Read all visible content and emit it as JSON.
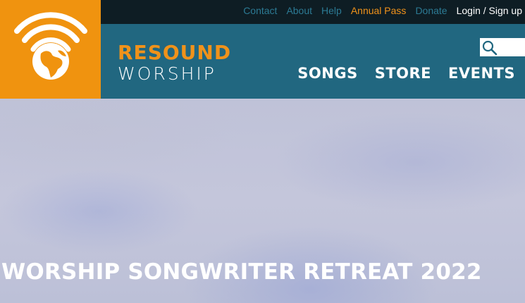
{
  "top_links": {
    "contact": "Contact",
    "about": "About",
    "help": "Help",
    "annual_pass": "Annual Pass",
    "donate": "Donate",
    "login": "Login / Sign up"
  },
  "brand": {
    "line1": "RESOUND",
    "line2": "WORSHIP",
    "logo_icon": "globe-broadcast-icon"
  },
  "search": {
    "placeholder": "",
    "icon": "search-icon"
  },
  "main_nav": {
    "songs": "SONGS",
    "store": "STORE",
    "events": "EVENTS"
  },
  "hero": {
    "title": "WORSHIP SONGWRITER RETREAT 2022"
  },
  "colors": {
    "accent_orange": "#f0921a",
    "header_teal": "#216780",
    "topbar_dark": "#0e1d24",
    "link_teal": "#2c7a94"
  }
}
